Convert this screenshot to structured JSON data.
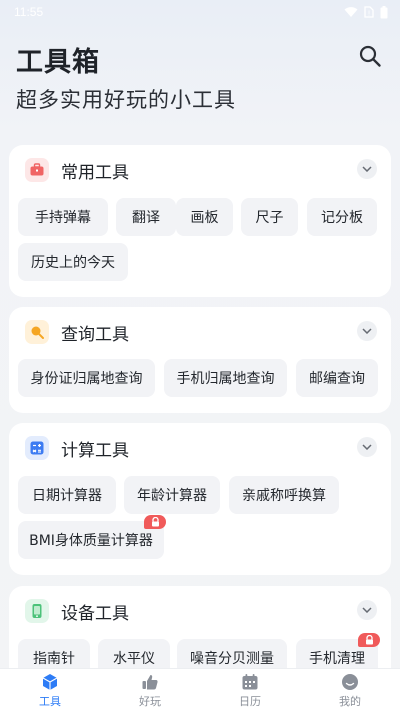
{
  "status": {
    "time": "11:55"
  },
  "header": {
    "title": "工具箱",
    "subtitle": "超多实用好玩的小工具"
  },
  "sections": [
    {
      "title": "常用工具",
      "icon": "toolbox-icon",
      "color": "#f06464",
      "tools": [
        {
          "label": "手持弹幕",
          "locked": false
        },
        {
          "label": "翻译",
          "locked": false
        },
        {
          "label": "画板",
          "locked": false
        },
        {
          "label": "尺子",
          "locked": false
        },
        {
          "label": "记分板",
          "locked": false
        },
        {
          "label": "历史上的今天",
          "locked": false
        }
      ]
    },
    {
      "title": "查询工具",
      "icon": "magnifier-icon",
      "color": "#f5a623",
      "tools": [
        {
          "label": "身份证归属地查询",
          "locked": false
        },
        {
          "label": "手机归属地查询",
          "locked": false
        },
        {
          "label": "邮编查询",
          "locked": false
        }
      ]
    },
    {
      "title": "计算工具",
      "icon": "calculator-icon",
      "color": "#3d7cf2",
      "tools": [
        {
          "label": "日期计算器",
          "locked": false
        },
        {
          "label": "年龄计算器",
          "locked": false
        },
        {
          "label": "亲戚称呼换算",
          "locked": false
        },
        {
          "label": "BMI身体质量计算器",
          "locked": true
        }
      ]
    },
    {
      "title": "设备工具",
      "icon": "phone-device-icon",
      "color": "#4cc27a",
      "tools": [
        {
          "label": "指南针",
          "locked": false
        },
        {
          "label": "水平仪",
          "locked": false
        },
        {
          "label": "噪音分贝测量",
          "locked": false
        },
        {
          "label": "手机清理",
          "locked": true
        }
      ]
    }
  ],
  "tabs": [
    {
      "label": "工具",
      "icon": "cube-icon",
      "active": true
    },
    {
      "label": "好玩",
      "icon": "thumbs-up-icon",
      "active": false
    },
    {
      "label": "日历",
      "icon": "calendar-icon",
      "active": false
    },
    {
      "label": "我的",
      "icon": "profile-face-icon",
      "active": false
    }
  ],
  "colors": {
    "accent": "#2d7cf6",
    "lock": "#f05a5a",
    "chip_bg": "#f2f3f6"
  }
}
